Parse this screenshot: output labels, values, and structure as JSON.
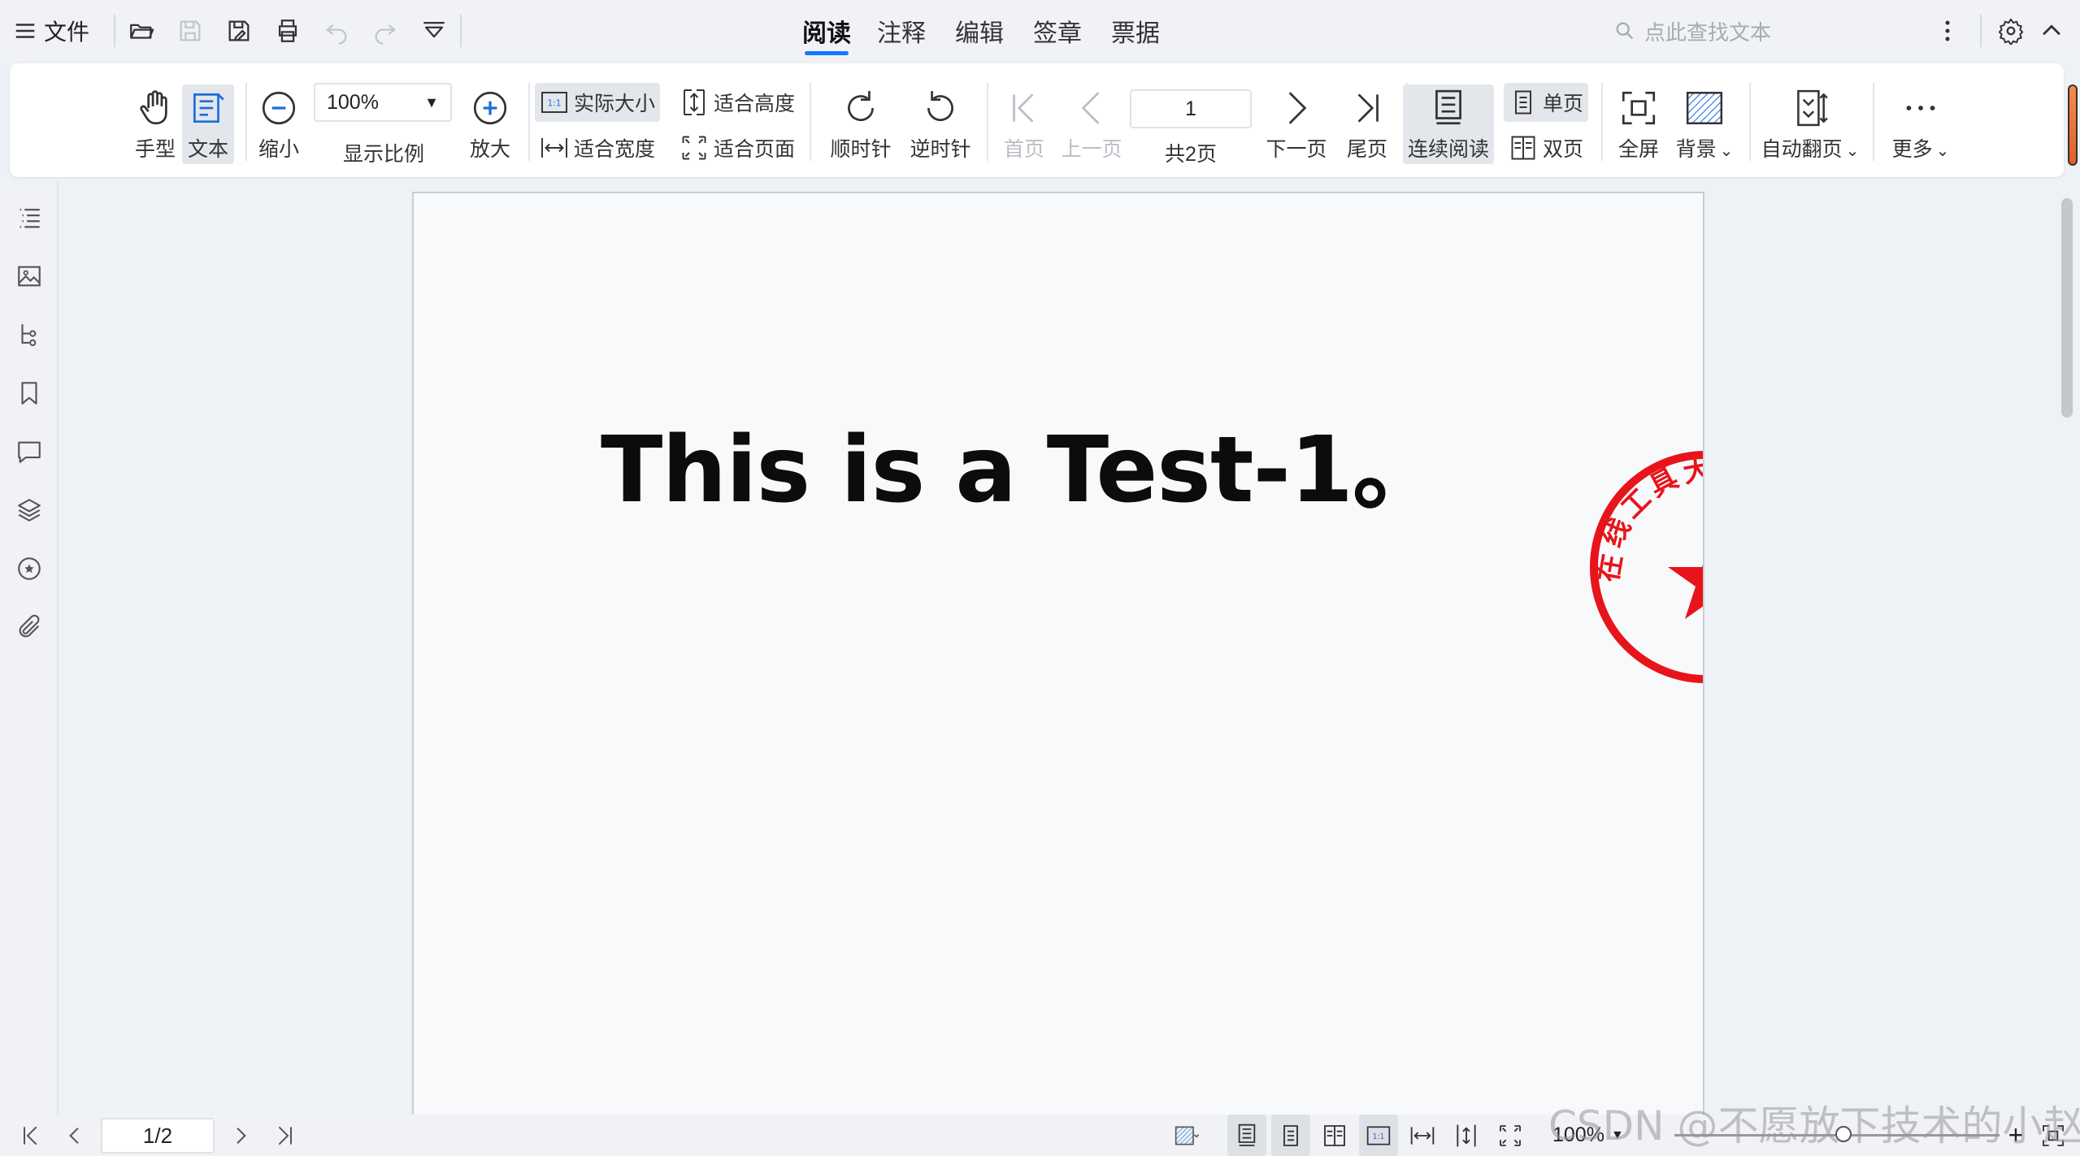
{
  "menubar": {
    "file_label": "文件",
    "tabs": [
      "阅读",
      "注释",
      "编辑",
      "签章",
      "票据"
    ],
    "active_tab": "阅读",
    "search_placeholder": "点此查找文本"
  },
  "ribbon": {
    "hand": "手型",
    "text": "文本",
    "zoom_out": "缩小",
    "zoom_value": "100%",
    "zoom_label": "显示比例",
    "zoom_in": "放大",
    "actual_size": "实际大小",
    "fit_width": "适合宽度",
    "fit_height": "适合高度",
    "fit_page": "适合页面",
    "rotate_cw": "顺时针",
    "rotate_ccw": "逆时针",
    "first_page": "首页",
    "prev_page": "上一页",
    "page_number": "1",
    "total_pages": "共2页",
    "next_page": "下一页",
    "last_page": "尾页",
    "continuous": "连续阅读",
    "single": "单页",
    "double": "双页",
    "fullscreen": "全屏",
    "background": "背景",
    "auto_flip": "自动翻页",
    "more": "更多"
  },
  "document": {
    "text": "This is a Test-1。",
    "stamp_text": "在线工具大全",
    "stamp_color": "#e8141b"
  },
  "statusbar": {
    "page_indicator": "1/2",
    "zoom": "100%"
  },
  "watermark": "CSDN @不愿放下技术的小赵",
  "colors": {
    "accent": "#1677ff",
    "stamp": "#e8141b"
  }
}
